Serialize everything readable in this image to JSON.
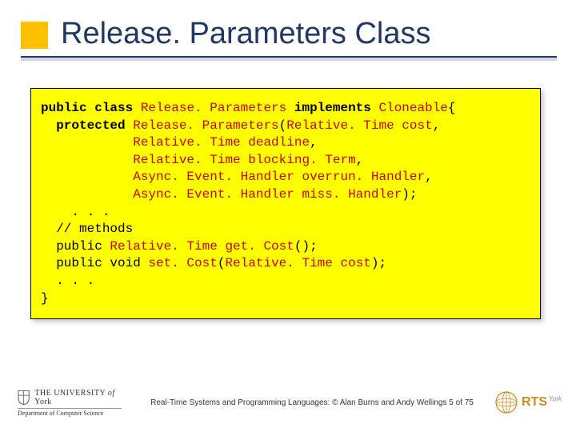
{
  "title": "Release. Parameters Class",
  "code": {
    "l1a": "public class ",
    "l1b": "Release. Parameters",
    "l1c": " implements ",
    "l1d": "Cloneable",
    "l1e": "{",
    "blank1": "",
    "l2a": "  protected ",
    "l2b": "Release. Parameters",
    "l2c": "(",
    "l2d": "Relative. Time",
    "l2e": " ",
    "l2f": "cost",
    "l2g": ",",
    "l3a": "            ",
    "l3b": "Relative. Time",
    "l3c": " ",
    "l3d": "deadline",
    "l3e": ",",
    "l4a": "            ",
    "l4b": "Relative. Time",
    "l4c": " ",
    "l4d": "blocking. Term",
    "l4e": ",",
    "l5a": "            ",
    "l5b": "Async. Event. Handler",
    "l5c": " ",
    "l5d": "overrun. Handler",
    "l5e": ",",
    "l6a": "            ",
    "l6b": "Async. Event. Handler",
    "l6c": " ",
    "l6d": "miss. Handler",
    "l6e": ");",
    "l7": "    . . .",
    "l8": "  // methods",
    "l9a": "  public ",
    "l9b": "Relative. Time",
    "l9c": " ",
    "l9d": "get. Cost",
    "l9e": "();",
    "l10a": "  public void ",
    "l10b": "set. Cost",
    "l10c": "(",
    "l10d": "Relative. Time",
    "l10e": " ",
    "l10f": "cost",
    "l10g": ");",
    "l11": "  . . .",
    "l12": "}"
  },
  "footer": {
    "uoy_line1_a": "THE UNIVERSITY",
    "uoy_line1_b": "of",
    "uoy_line1_c": "York",
    "uoy_dept": "Department of Computer Science",
    "center": "Real-Time Systems and Programming Languages: © Alan Burns and Andy Wellings  5 of 75",
    "rts": "RTS",
    "rts_york": "York"
  },
  "colors": {
    "accent": "#1f3864",
    "bullet": "#ffc000",
    "codebg": "#ffff00",
    "ident": "#d00000",
    "rts": "#d08a1a"
  }
}
